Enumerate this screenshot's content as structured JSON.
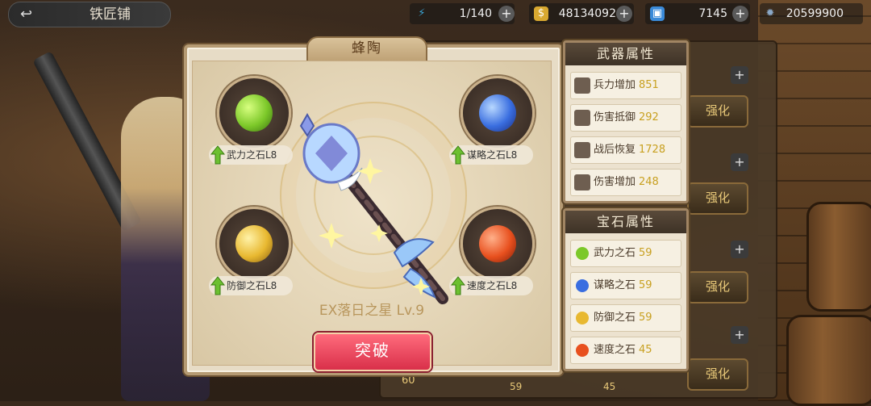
{
  "topbar": {
    "back_arrow": "↩",
    "title": "铁匠铺",
    "resources": [
      {
        "icon": "lightning-icon",
        "value": "1/140",
        "color": "#3aa6d8"
      },
      {
        "icon": "gold-coin-icon",
        "value": "48134092",
        "color": "#d8a830"
      },
      {
        "icon": "ticket-icon",
        "value": "7145",
        "color": "#3a8ad8"
      },
      {
        "icon": "gear-gem-icon",
        "value": "20599900",
        "color": "#8aa8c8"
      }
    ],
    "plus": "+"
  },
  "panel": {
    "tab_title": "蜂陶",
    "weapon_name": "EX落日之星 Lv.9",
    "break_button": "突破",
    "gems": [
      {
        "label": "武力之石L8",
        "color": "#7cc829"
      },
      {
        "label": "谋略之石L8",
        "color": "#3a6ee0"
      },
      {
        "label": "防御之石L8",
        "color": "#e8b830"
      },
      {
        "label": "速度之石L8",
        "color": "#e8501e"
      }
    ]
  },
  "weapon_attrs": {
    "title": "武器属性",
    "items": [
      {
        "label": "兵力增加",
        "value": "851"
      },
      {
        "label": "伤害抵御",
        "value": "292"
      },
      {
        "label": "战后恢复",
        "value": "1728"
      },
      {
        "label": "伤害增加",
        "value": "248"
      }
    ]
  },
  "gem_attrs": {
    "title": "宝石属性",
    "items": [
      {
        "label": "武力之石",
        "value": "59",
        "color": "#7cc829"
      },
      {
        "label": "谋略之石",
        "value": "59",
        "color": "#3a6ee0"
      },
      {
        "label": "防御之石",
        "value": "59",
        "color": "#e8b830"
      },
      {
        "label": "速度之石",
        "value": "45",
        "color": "#e8501e"
      }
    ]
  },
  "side": {
    "enhance": "强化",
    "bottom_level": "60",
    "bottom_stats": [
      "59",
      "45"
    ]
  }
}
